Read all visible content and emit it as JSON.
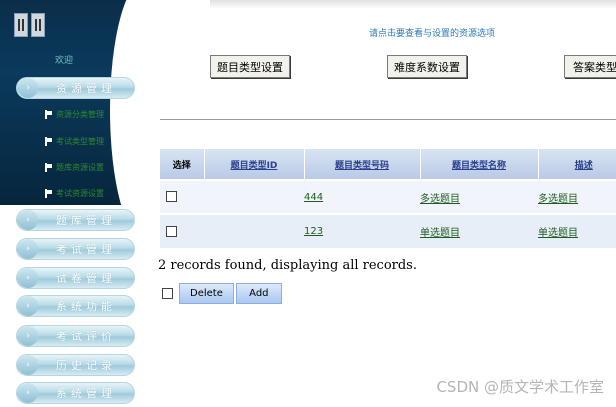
{
  "sidebar": {
    "welcome": "欢迎",
    "sections": [
      {
        "label": "资源管理"
      },
      {
        "label": "题库管理"
      },
      {
        "label": "考试管理"
      },
      {
        "label": "试卷管理"
      },
      {
        "label": "系统功能"
      },
      {
        "label": "考试评价"
      },
      {
        "label": "历史记录"
      },
      {
        "label": "系统管理"
      }
    ],
    "sub_items": [
      {
        "label": "资源分类管理"
      },
      {
        "label": "考试类型管理"
      },
      {
        "label": "题库资源设置"
      },
      {
        "label": "考试资源设置"
      }
    ]
  },
  "header": {
    "hint": "请点击要查看与设置的资源选项",
    "buttons": [
      {
        "label": "题目类型设置"
      },
      {
        "label": "难度系数设置"
      },
      {
        "label": "答案类型设置"
      }
    ]
  },
  "table": {
    "columns": [
      "选择",
      "题目类型ID",
      "题目类型号码",
      "题目类型名称",
      "描述"
    ],
    "rows": [
      {
        "id": "",
        "code": "444",
        "name": "多选题目",
        "desc": "多选题目"
      },
      {
        "id": "",
        "code": "123",
        "name": "单选题目",
        "desc": "单选题目"
      }
    ]
  },
  "footer": {
    "records_text": "2 records found, displaying all records.",
    "delete_label": "Delete",
    "add_label": "Add"
  },
  "watermark": "CSDN @质文学术工作室"
}
